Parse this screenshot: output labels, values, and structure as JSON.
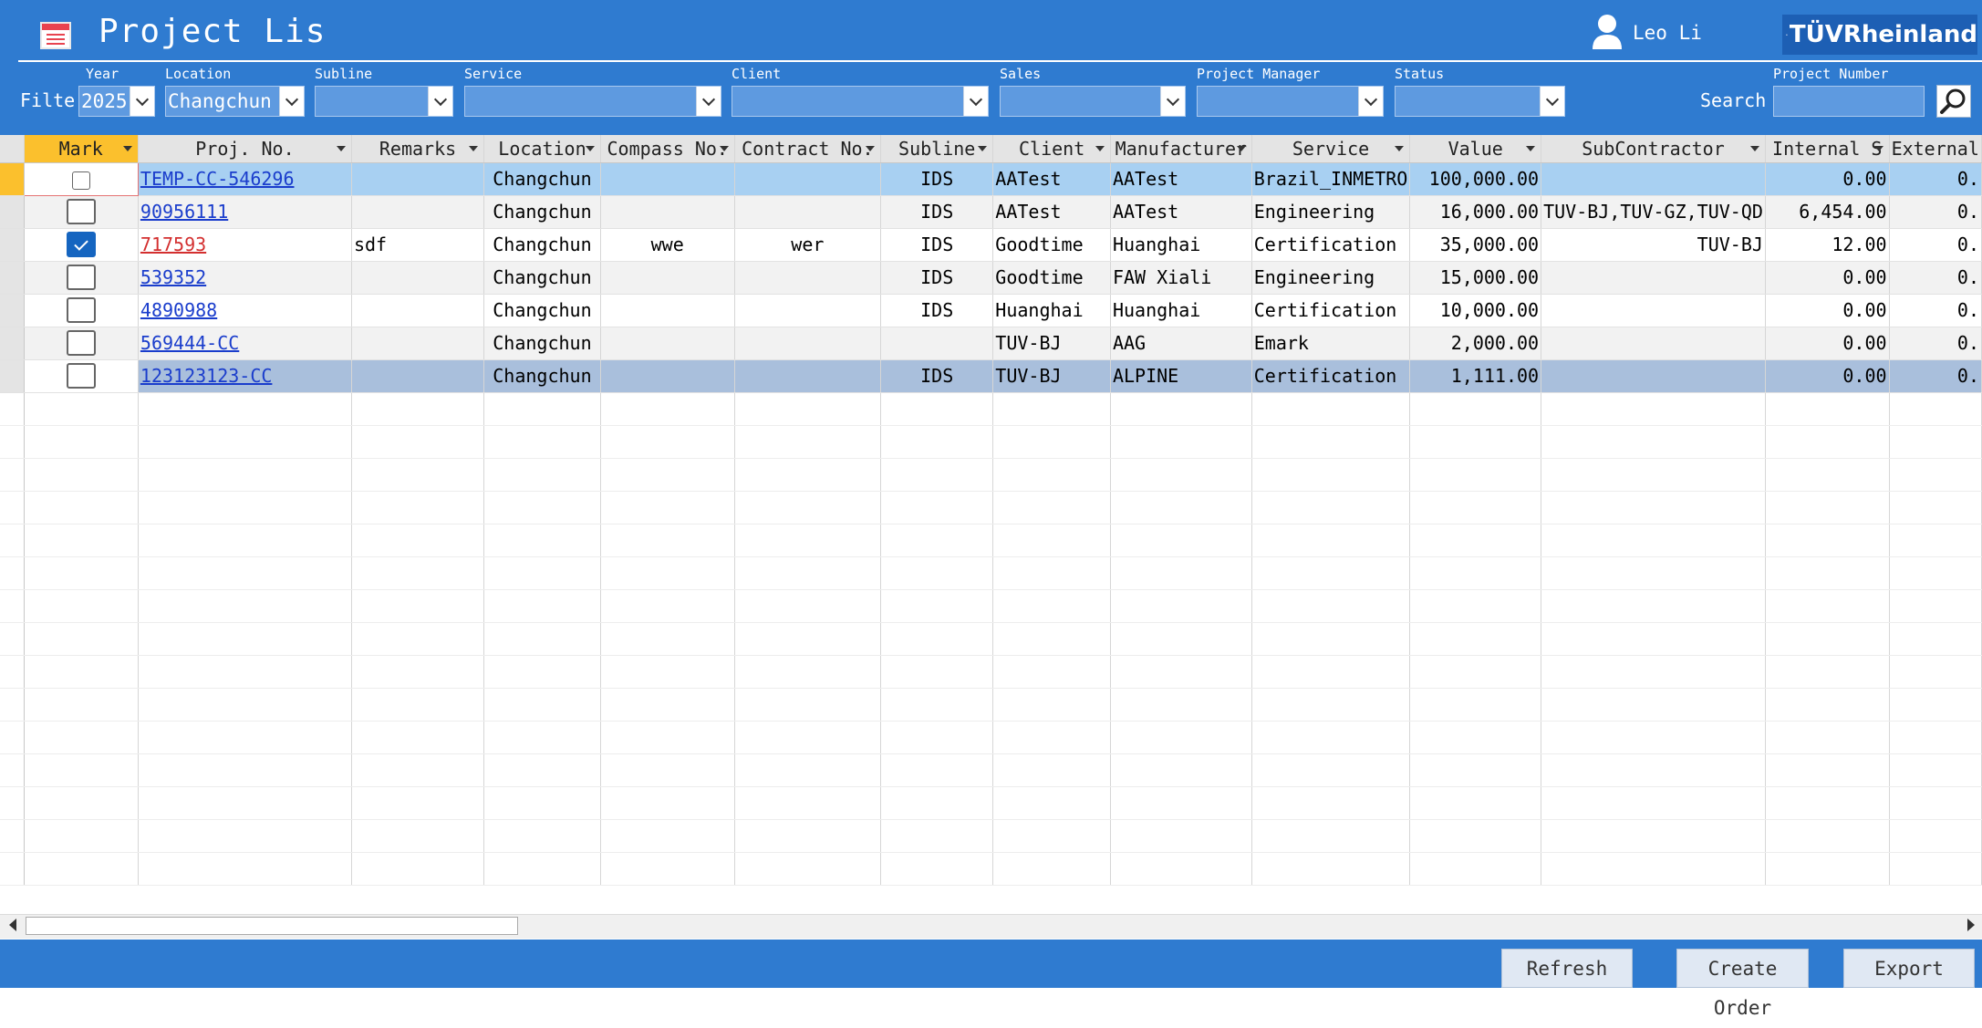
{
  "header": {
    "title": "Project Lis",
    "user_name": "Leo Li",
    "logo_text": "TÜVRheinland",
    "filter_label": "Filte",
    "search_label": "Search"
  },
  "filters": {
    "year": {
      "label": "Year",
      "value": "2025"
    },
    "location": {
      "label": "Location",
      "value": "Changchun"
    },
    "subline": {
      "label": "Subline",
      "value": ""
    },
    "service": {
      "label": "Service",
      "value": ""
    },
    "client": {
      "label": "Client",
      "value": ""
    },
    "sales": {
      "label": "Sales",
      "value": ""
    },
    "project_manager": {
      "label": "Project Manager",
      "value": ""
    },
    "status": {
      "label": "Status",
      "value": ""
    },
    "project_number": {
      "label": "Project Number",
      "value": ""
    }
  },
  "grid": {
    "columns": {
      "mark": "Mark",
      "proj_no": "Proj. No.",
      "remarks": "Remarks",
      "location": "Location",
      "compass_no": "Compass No.",
      "contract_no": "Contract No.",
      "subline": "Subline",
      "client": "Client",
      "manufacturer": "Manufacturer",
      "service": "Service",
      "value": "Value",
      "subcontractor": "SubContractor",
      "internal_s": "Internal S",
      "external": "External"
    },
    "rows": [
      {
        "proj_no": "TEMP-CC-546296",
        "remarks": "",
        "location": "Changchun",
        "compass_no": "",
        "contract_no": "",
        "subline": "IDS",
        "client": "AATest",
        "manufacturer": "AATest",
        "service": "Brazil_INMETRO",
        "value": "100,000.00",
        "subcontractor": "",
        "internal_s": "0.00",
        "external": "0."
      },
      {
        "proj_no": "90956111",
        "remarks": "",
        "location": "Changchun",
        "compass_no": "",
        "contract_no": "",
        "subline": "IDS",
        "client": "AATest",
        "manufacturer": "AATest",
        "service": "Engineering",
        "value": "16,000.00",
        "subcontractor": "TUV-BJ,TUV-GZ,TUV-QD",
        "internal_s": "6,454.00",
        "external": "0."
      },
      {
        "proj_no": "717593",
        "remarks": "sdf",
        "location": "Changchun",
        "compass_no": "wwe",
        "contract_no": "wer",
        "subline": "IDS",
        "client": "Goodtime",
        "manufacturer": "Huanghai",
        "service": "Certification",
        "value": "35,000.00",
        "subcontractor": "TUV-BJ",
        "internal_s": "12.00",
        "external": "0."
      },
      {
        "proj_no": "539352",
        "remarks": "",
        "location": "Changchun",
        "compass_no": "",
        "contract_no": "",
        "subline": "IDS",
        "client": "Goodtime",
        "manufacturer": "FAW Xiali",
        "service": "Engineering",
        "value": "15,000.00",
        "subcontractor": "",
        "internal_s": "0.00",
        "external": "0."
      },
      {
        "proj_no": "4890988",
        "remarks": "",
        "location": "Changchun",
        "compass_no": "",
        "contract_no": "",
        "subline": "IDS",
        "client": "Huanghai",
        "manufacturer": "Huanghai",
        "service": "Certification",
        "value": "10,000.00",
        "subcontractor": "",
        "internal_s": "0.00",
        "external": "0."
      },
      {
        "proj_no": "569444-CC",
        "remarks": "",
        "location": "Changchun",
        "compass_no": "",
        "contract_no": "",
        "subline": "",
        "client": "TUV-BJ",
        "manufacturer": "AAG",
        "service": "Emark",
        "value": "2,000.00",
        "subcontractor": "",
        "internal_s": "0.00",
        "external": "0."
      },
      {
        "proj_no": "123123123-CC",
        "remarks": "",
        "location": "Changchun",
        "compass_no": "",
        "contract_no": "",
        "subline": "IDS",
        "client": "TUV-BJ",
        "manufacturer": "ALPINE",
        "service": "Certification",
        "value": "1,111.00",
        "subcontractor": "",
        "internal_s": "0.00",
        "external": "0."
      }
    ]
  },
  "footer": {
    "refresh": "Refresh",
    "create_order": "Create Order",
    "export": "Export"
  },
  "colors": {
    "header_bg": "#2f7bd0",
    "current_row_marker": "#fbc02d",
    "row_highlight": "#a8d0f2",
    "link": "#1a3dcc"
  }
}
